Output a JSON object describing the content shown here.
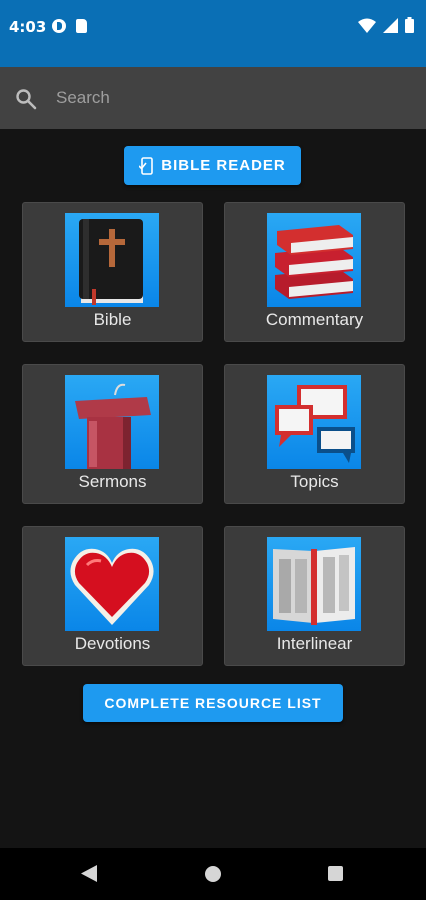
{
  "status_bar": {
    "time": "4:03"
  },
  "search": {
    "placeholder": "Search"
  },
  "bible_reader_button": {
    "label": "BIBLE READER"
  },
  "tiles": [
    {
      "label": "Bible",
      "icon": "bible-icon"
    },
    {
      "label": "Commentary",
      "icon": "books-icon"
    },
    {
      "label": "Sermons",
      "icon": "pulpit-icon"
    },
    {
      "label": "Topics",
      "icon": "speech-bubbles-icon"
    },
    {
      "label": "Devotions",
      "icon": "heart-icon"
    },
    {
      "label": "Interlinear",
      "icon": "open-book-icon"
    }
  ],
  "resource_list_button": {
    "label": "COMPLETE RESOURCE LIST"
  },
  "colors": {
    "accent": "#1e9af0",
    "status_bar": "#0a6fb5",
    "background": "#141414",
    "tile": "#3b3b3b"
  }
}
